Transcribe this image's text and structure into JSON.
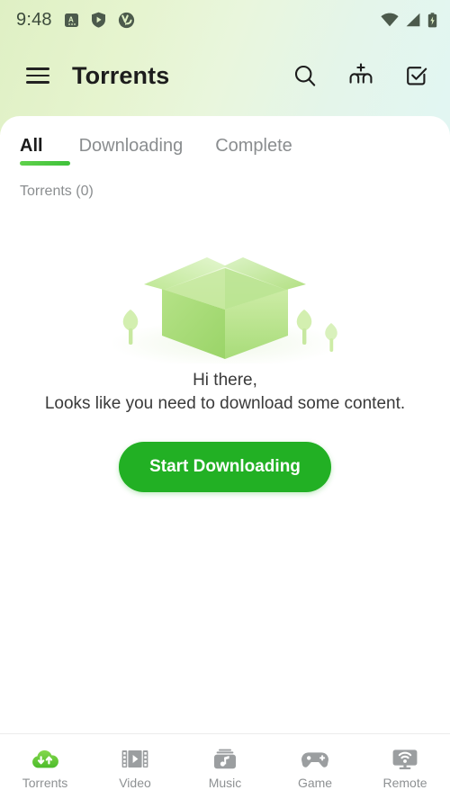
{
  "colors": {
    "accent_green": "#22b024",
    "tab_indicator": "#4fc93f",
    "gradient_left": "#dff0c4",
    "gradient_right": "#e2f6f3",
    "muted_text": "#8b8e90",
    "nav_inactive": "#8e9193",
    "illustration_green": "#b7e08a"
  },
  "status_bar": {
    "time": "9:48",
    "left_icons": [
      "app-notification-icon",
      "shield-play-icon",
      "vpn-badge-icon"
    ],
    "right_icons": [
      "wifi-icon",
      "cellular-signal-icon",
      "battery-charging-icon"
    ]
  },
  "app_bar": {
    "menu_icon": "hamburger-menu-icon",
    "title": "Torrents",
    "actions": [
      {
        "name": "search-button",
        "icon": "search-icon"
      },
      {
        "name": "add-torrent-button",
        "icon": "add-link-icon"
      },
      {
        "name": "select-mode-button",
        "icon": "checkbox-check-icon"
      }
    ]
  },
  "tabs": [
    {
      "label": "All",
      "active": true
    },
    {
      "label": "Downloading",
      "active": false
    },
    {
      "label": "Complete",
      "active": false
    }
  ],
  "list": {
    "count_label": "Torrents (0)"
  },
  "empty_state": {
    "illustration": "empty-box-illustration",
    "greeting": "Hi there,",
    "message": "Looks like you need to download some content.",
    "cta_label": "Start Downloading"
  },
  "bottom_nav": [
    {
      "label": "Torrents",
      "icon": "cloud-transfer-icon",
      "active": true
    },
    {
      "label": "Video",
      "icon": "film-strip-icon",
      "active": false
    },
    {
      "label": "Music",
      "icon": "music-box-icon",
      "active": false
    },
    {
      "label": "Game",
      "icon": "gamepad-icon",
      "active": false
    },
    {
      "label": "Remote",
      "icon": "monitor-wifi-icon",
      "active": false
    }
  ]
}
